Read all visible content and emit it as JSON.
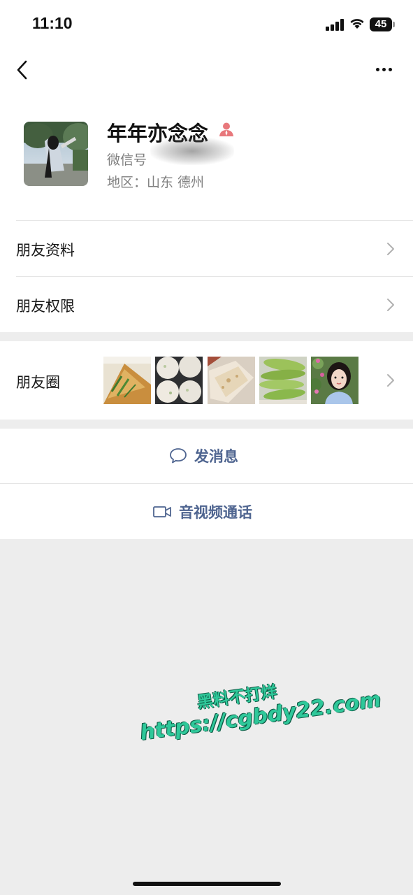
{
  "status_bar": {
    "time": "11:10",
    "battery": "45"
  },
  "nav": {
    "back_icon": "chevron-left-icon",
    "more_icon": "more-dots-icon"
  },
  "profile": {
    "nickname": "年年亦念念",
    "badge_icon": "user-icon",
    "wechat_id_label": "微信号",
    "region": "地区：山东 德州"
  },
  "menu": {
    "friend_info": "朋友资料",
    "friend_permissions": "朋友权限",
    "moments": "朋友圈"
  },
  "actions": {
    "send_message": "发消息",
    "video_call": "音视频通话"
  },
  "watermark": {
    "line1": "黑料不打烊",
    "line2": "https://cgbdy22.com"
  },
  "colors": {
    "accent_text": "#4f6590",
    "background": "#ededed",
    "card": "#ffffff",
    "watermark": "#2fc89a"
  }
}
